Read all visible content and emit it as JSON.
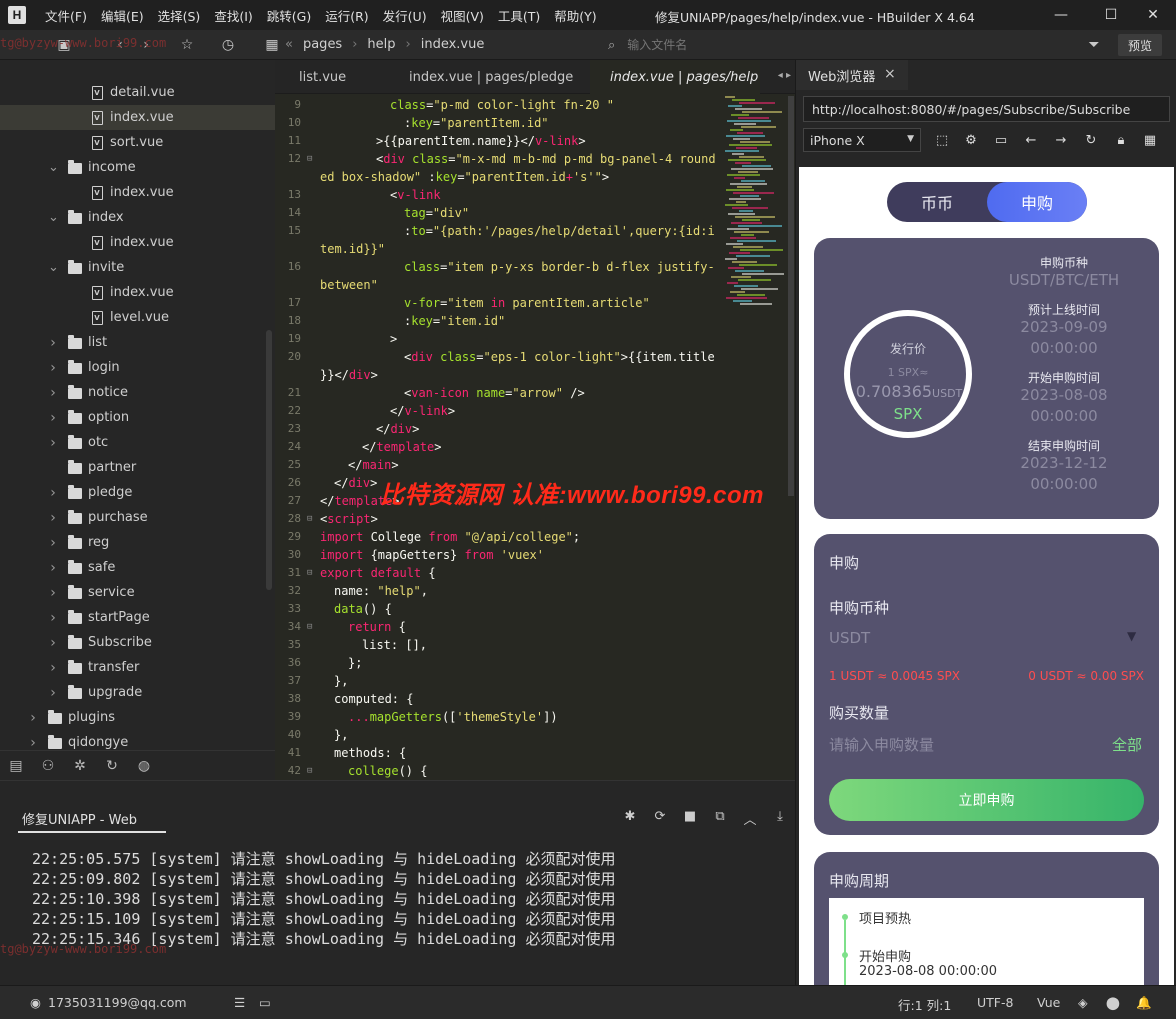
{
  "app": {
    "logo": "H",
    "title": "修复UNIAPP/pages/help/index.vue - HBuilder X 4.64",
    "menus": [
      "文件(F)",
      "编辑(E)",
      "选择(S)",
      "查找(I)",
      "跳转(G)",
      "运行(R)",
      "发行(U)",
      "视图(V)",
      "工具(T)",
      "帮助(Y)"
    ],
    "window_controls": {
      "minimize": "—",
      "maximize": "☐",
      "close": "✕"
    }
  },
  "toolbar": {
    "breadcrumb": [
      "pages",
      "help",
      "index.vue"
    ],
    "file_search_placeholder": "输入文件名",
    "preview_label": "预览"
  },
  "file_tree": {
    "items": [
      {
        "label": "detail.vue",
        "type": "file"
      },
      {
        "label": "index.vue",
        "type": "file",
        "selected": true
      },
      {
        "label": "sort.vue",
        "type": "file"
      },
      {
        "label": "income",
        "type": "folder",
        "expanded": true
      },
      {
        "label": "index.vue",
        "type": "file"
      },
      {
        "label": "index",
        "type": "folder",
        "expanded": true
      },
      {
        "label": "index.vue",
        "type": "file"
      },
      {
        "label": "invite",
        "type": "folder",
        "expanded": true
      },
      {
        "label": "index.vue",
        "type": "file"
      },
      {
        "label": "level.vue",
        "type": "file"
      },
      {
        "label": "list",
        "type": "folder"
      },
      {
        "label": "login",
        "type": "folder"
      },
      {
        "label": "notice",
        "type": "folder"
      },
      {
        "label": "option",
        "type": "folder"
      },
      {
        "label": "otc",
        "type": "folder"
      },
      {
        "label": "partner",
        "type": "folder",
        "no_chevron": true
      },
      {
        "label": "pledge",
        "type": "folder"
      },
      {
        "label": "purchase",
        "type": "folder"
      },
      {
        "label": "reg",
        "type": "folder"
      },
      {
        "label": "safe",
        "type": "folder"
      },
      {
        "label": "service",
        "type": "folder"
      },
      {
        "label": "startPage",
        "type": "folder"
      },
      {
        "label": "Subscribe",
        "type": "folder"
      },
      {
        "label": "transfer",
        "type": "folder"
      },
      {
        "label": "upgrade",
        "type": "folder"
      },
      {
        "label": "plugins",
        "type": "folder"
      },
      {
        "label": "qidongye",
        "type": "folder"
      }
    ]
  },
  "editor": {
    "tabs": [
      "list.vue",
      "index.vue | pages/pledge",
      "index.vue | pages/help"
    ],
    "lines": [
      {
        "n": "9",
        "html": "<span class='a'>class</span><span class='w'>=</span><span class='s'>\"p-md color-light fn-20 \"</span>"
      },
      {
        "n": "10",
        "html": "<span class='w'>:</span><span class='a'>key</span><span class='w'>=</span><span class='s'>\"parentItem.id\"</span>"
      },
      {
        "n": "11",
        "html": "<span class='w'>&gt;{{parentItem.name}}&lt;/</span><span class='k'>v-link</span><span class='w'>&gt;</span>"
      },
      {
        "n": "12",
        "html": "<span class='w'>&lt;</span><span class='k'>div</span> <span class='a'>class</span><span class='w'>=</span><span class='s'>\"m-x-md m-b-md p-md bg-panel-4 round</span>"
      },
      {
        "n": "",
        "html": "<span class='s'>ed box-shadow\"</span> <span class='w'>:</span><span class='a'>key</span><span class='w'>=</span><span class='s'>\"parentItem.id</span><span class='k'>+</span><span class='s'>'s'\"</span><span class='w'>&gt;</span>"
      },
      {
        "n": "13",
        "html": "<span class='w'>&lt;</span><span class='k'>v-link</span>"
      },
      {
        "n": "14",
        "html": "<span class='a'>tag</span><span class='w'>=</span><span class='s'>\"div\"</span>"
      },
      {
        "n": "15",
        "html": "<span class='w'>:</span><span class='a'>to</span><span class='w'>=</span><span class='s'>\"{path:'/pages/help/detail',query:{id:i</span>"
      },
      {
        "n": "",
        "html": "<span class='s'>tem.id}}\"</span>"
      },
      {
        "n": "16",
        "html": "<span class='a'>class</span><span class='w'>=</span><span class='s'>\"item p-y-xs border-b d-flex justify-</span>"
      },
      {
        "n": "",
        "html": "<span class='s'>between\"</span>"
      },
      {
        "n": "17",
        "html": "<span class='a'>v-for</span><span class='w'>=</span><span class='s'>\"item </span><span class='k'>in</span><span class='s'> parentItem.article\"</span>"
      },
      {
        "n": "18",
        "html": "<span class='w'>:</span><span class='a'>key</span><span class='w'>=</span><span class='s'>\"item.id\"</span>"
      },
      {
        "n": "19",
        "html": "<span class='w'>&gt;</span>"
      },
      {
        "n": "20",
        "html": "<span class='w'>&lt;</span><span class='k'>div</span> <span class='a'>class</span><span class='w'>=</span><span class='s'>\"eps-1 color-light\"</span><span class='w'>&gt;{{item.title</span>"
      },
      {
        "n": "",
        "html": "<span class='w'>}}&lt;/</span><span class='k'>div</span><span class='w'>&gt;</span>"
      },
      {
        "n": "21",
        "html": "<span class='w'>&lt;</span><span class='k'>van-icon</span> <span class='a'>name</span><span class='w'>=</span><span class='s'>\"arrow\"</span> <span class='w'>/&gt;</span>"
      },
      {
        "n": "22",
        "html": "<span class='w'>&lt;/</span><span class='k'>v-link</span><span class='w'>&gt;</span>"
      },
      {
        "n": "23",
        "html": "<span class='w'>&lt;/</span><span class='k'>div</span><span class='w'>&gt;</span>"
      },
      {
        "n": "24",
        "html": "<span class='w'>&lt;/</span><span class='k'>template</span><span class='w'>&gt;</span>"
      },
      {
        "n": "25",
        "html": "<span class='w'>&lt;/</span><span class='k'>main</span><span class='w'>&gt;</span>"
      },
      {
        "n": "26",
        "html": "<span class='w'>&lt;/</span><span class='k'>div</span><span class='w'>&gt;</span>"
      },
      {
        "n": "27",
        "html": "<span class='w'>&lt;/</span><span class='k'>template</span><span class='w'>&gt;</span>"
      },
      {
        "n": "28",
        "html": "<span class='w'>&lt;</span><span class='k'>script</span><span class='w'>&gt;</span>"
      },
      {
        "n": "29",
        "html": "<span class='k'>import</span><span class='w'> College </span><span class='k'>from</span> <span class='s'>\"@/api/college\"</span><span class='w'>;</span>"
      },
      {
        "n": "30",
        "html": "<span class='k'>import</span><span class='w'> {mapGetters} </span><span class='k'>from</span> <span class='s'>'vuex'</span>"
      },
      {
        "n": "31",
        "html": "<span class='k'>export default</span><span class='w'> {</span>"
      },
      {
        "n": "32",
        "html": "<span class='w'>name: </span><span class='s'>\"help\"</span><span class='w'>,</span>"
      },
      {
        "n": "33",
        "html": "<span class='a'>data</span><span class='w'>() {</span>"
      },
      {
        "n": "34",
        "html": "<span class='k'>return</span><span class='w'> {</span>"
      },
      {
        "n": "35",
        "html": "<span class='w'>list: [],</span>"
      },
      {
        "n": "36",
        "html": "<span class='w'>};</span>"
      },
      {
        "n": "37",
        "html": "<span class='w'>},</span>"
      },
      {
        "n": "38",
        "html": "<span class='w'>computed: {</span>"
      },
      {
        "n": "39",
        "html": "<span class='k'>...</span><span class='a'>mapGetters</span><span class='w'>([</span><span class='s'>'themeStyle'</span><span class='w'>])</span>"
      },
      {
        "n": "40",
        "html": "<span class='w'>},</span>"
      },
      {
        "n": "41",
        "html": "<span class='w'>methods: {</span>"
      },
      {
        "n": "42",
        "html": "<span class='a'>college</span><span class='w'>() {</span>"
      }
    ],
    "watermark": "比特资源网 认准:www.bori99.com"
  },
  "console": {
    "tab": "修复UNIAPP - Web",
    "logs": [
      "22:25:05.575 [system] 请注意 showLoading 与 hideLoading 必须配对使用",
      "22:25:09.802 [system] 请注意 showLoading 与 hideLoading 必须配对使用",
      "22:25:10.398 [system] 请注意 showLoading 与 hideLoading 必须配对使用",
      "22:25:15.109 [system] 请注意 showLoading 与 hideLoading 必须配对使用",
      "22:25:15.346 [system] 请注意 showLoading 与 hideLoading 必须配对使用"
    ],
    "tg_mark": "tg@byzyw-www.bori99.com"
  },
  "status": {
    "user": "1735031199@qq.com",
    "position": "行:1  列:1",
    "encoding": "UTF-8",
    "language": "Vue"
  },
  "browser": {
    "tab_label": "Web浏览器",
    "url": "http://localhost:8080/#/pages/Subscribe/Subscribe",
    "device": "iPhone X"
  },
  "phone": {
    "segment": {
      "left": "币币",
      "right": "申购"
    },
    "issue": {
      "price_title": "发行价",
      "price_unit_line": "1 SPX≈",
      "price_value": "0.708365",
      "price_currency": "USDT",
      "price_token": "SPX",
      "info": [
        {
          "label": "申购币种",
          "value": "USDT/BTC/ETH"
        },
        {
          "label": "预计上线时间",
          "value": "2023-09-09 00:00:00"
        },
        {
          "label": "开始申购时间",
          "value": "2023-08-08 00:00:00"
        },
        {
          "label": "结束申购时间",
          "value": "2023-12-12 00:00:00"
        }
      ]
    },
    "subscribe": {
      "title": "申购",
      "coin_label": "申购币种",
      "coin_value": "USDT",
      "rate_left": "1 USDT ≈ 0.0045 SPX",
      "rate_right": "0 USDT ≈ 0.00 SPX",
      "qty_label": "购买数量",
      "qty_placeholder": "请输入申购数量",
      "all_label": "全部",
      "button": "立即申购"
    },
    "period": {
      "title": "申购周期",
      "steps": [
        {
          "name": "项目预热",
          "time": ""
        },
        {
          "name": "开始申购",
          "time": "2023-08-08 00:00:00"
        }
      ]
    }
  }
}
